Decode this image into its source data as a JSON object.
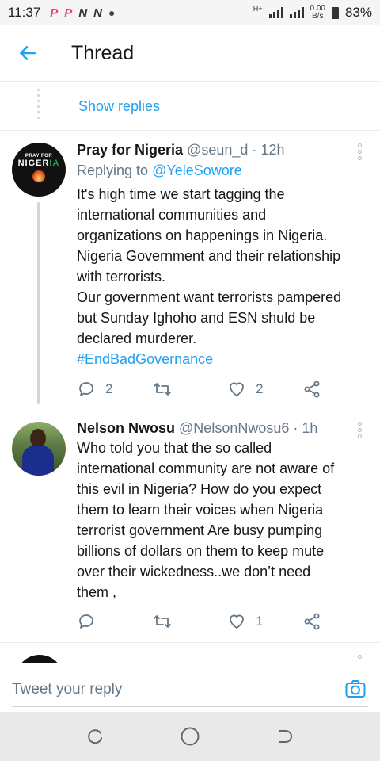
{
  "status_bar": {
    "time": "11:37",
    "app_icons": [
      "P",
      "P",
      "N",
      "N"
    ],
    "network_type": "H+",
    "speed_value": "0.00",
    "speed_unit": "B/s",
    "battery": "83%"
  },
  "header": {
    "back_icon": "arrow-left-icon",
    "title": "Thread"
  },
  "thread": {
    "show_replies_label": "Show replies",
    "tweets": [
      {
        "name": "Pray for Nigeria",
        "handle": "@seun_d",
        "separator": "·",
        "time": "12h",
        "replying_prefix": "Replying to",
        "replying_to": "@YeleSowore",
        "avatar_text_top": "PRAY FOR",
        "avatar_text_main_1": "NIGER",
        "avatar_text_main_2": "IA",
        "body_lines": [
          "It's high time we start tagging the",
          "international communities and",
          "organizations on happenings in Nigeria.",
          "Nigeria Government and their relationship",
          "with terrorists.",
          "Our government want terrorists pampered",
          "but Sunday Ighoho and ESN shuld be",
          "declared murderer."
        ],
        "hashtag": "#EndBadGovernance",
        "reply_count": "2",
        "retweet_count": "",
        "like_count": "2"
      },
      {
        "name": "Nelson Nwosu",
        "handle": "@NelsonNwosu6",
        "separator": "·",
        "time": "1h",
        "body_lines": [
          "Who told you that the so called",
          "international community are not aware of",
          "this evil in Nigeria? How do you expect",
          "them to learn their voices when Nigeria",
          "terrorist government Are busy pumping",
          "billions of dollars on them to keep mute",
          "over their wickedness..we don’t need",
          "them ,"
        ],
        "reply_count": "",
        "retweet_count": "",
        "like_count": "1"
      }
    ]
  },
  "reply_bar": {
    "placeholder": "Tweet your reply",
    "camera_icon": "camera-icon"
  },
  "nav_bar": {
    "recent_icon": "recent-apps-icon",
    "home_icon": "home-circle-icon",
    "back_icon": "back-nav-icon"
  },
  "colors": {
    "accent": "#1da1f2",
    "text": "#14171a",
    "muted": "#657786",
    "divider": "#e6ecf0"
  }
}
